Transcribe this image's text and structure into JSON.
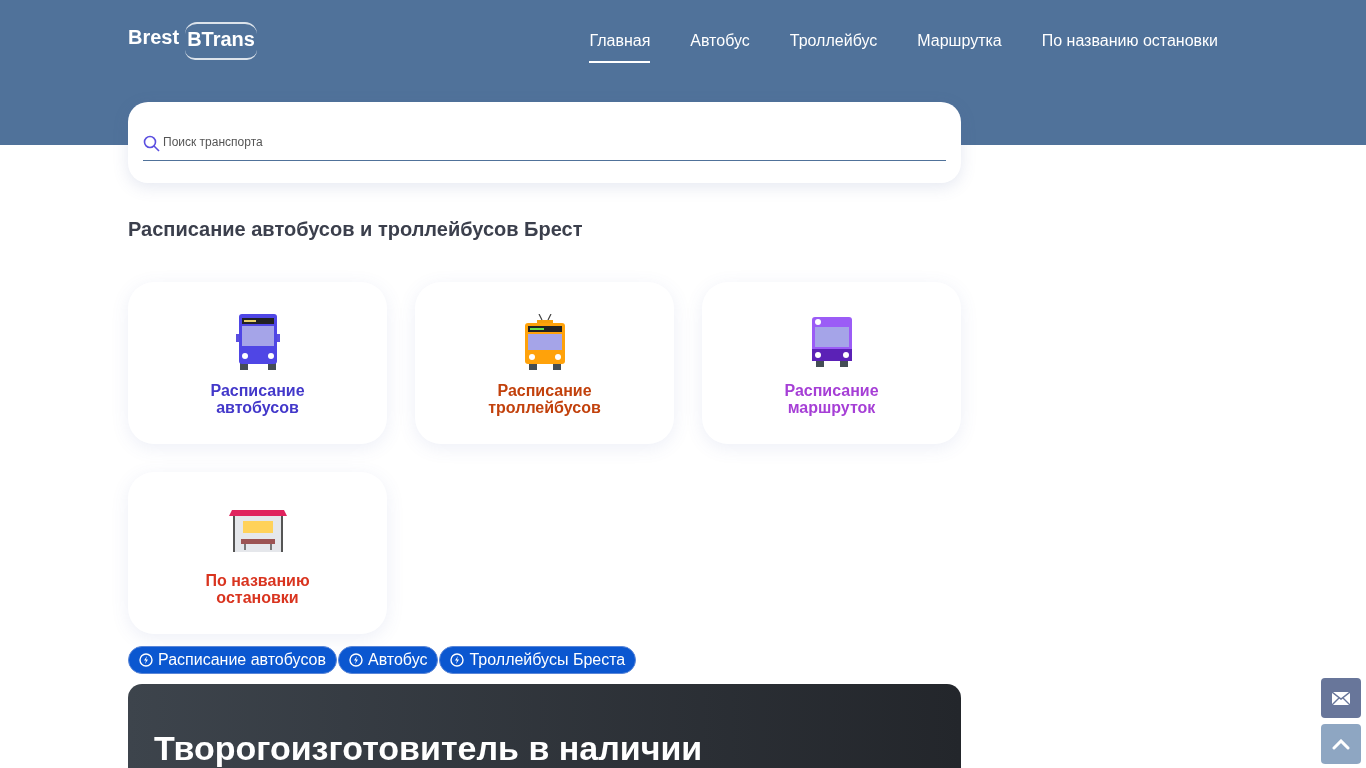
{
  "logo": {
    "word_1": "Brest",
    "word_2": "BTrans"
  },
  "nav": [
    {
      "label": "Главная",
      "selected": true
    },
    {
      "label": "Автобус",
      "selected": false
    },
    {
      "label": "Троллейбус",
      "selected": false
    },
    {
      "label": "Маршрутка",
      "selected": false
    },
    {
      "label": "По названию остановки",
      "selected": false
    }
  ],
  "search": {
    "placeholder": "Поиск транспорта"
  },
  "heading": "Расписание автобусов и троллейбусов Брест",
  "cards": [
    {
      "kind": "bus",
      "label": "Расписание автобусов",
      "color": "#4338ca"
    },
    {
      "kind": "trolleybus",
      "label": "Расписание троллейбусов",
      "color": "#c2410c"
    },
    {
      "kind": "minibus",
      "label": "Расписание маршруток",
      "color": "#a63fd6"
    },
    {
      "kind": "stop",
      "label": "По названию остановки",
      "color": "#d9341f"
    }
  ],
  "tags": [
    "Расписание автобусов",
    "Автобус",
    "Троллейбусы Бреста"
  ],
  "banner": {
    "title": "Творогоизготовитель в наличии"
  }
}
